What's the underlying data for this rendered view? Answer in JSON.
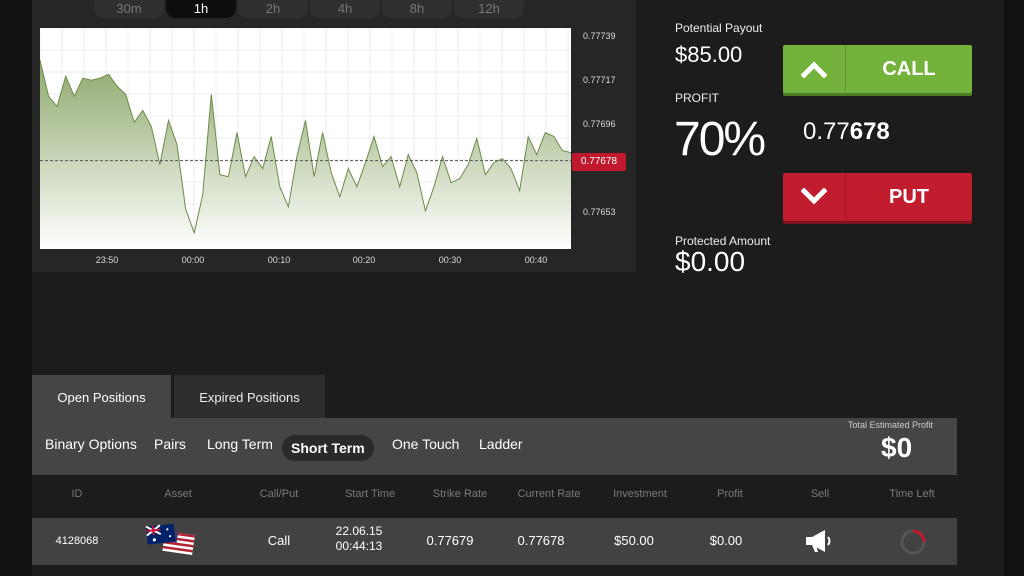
{
  "time_tabs": [
    "30m",
    "1h",
    "2h",
    "4h",
    "8h",
    "12h"
  ],
  "active_time_tab": "1h",
  "chart_data": {
    "type": "area",
    "x_tick_labels": [
      "23:50",
      "00:00",
      "00:10",
      "00:20",
      "00:30",
      "00:40"
    ],
    "x": [
      "23:42",
      "23:43",
      "23:44",
      "23:45",
      "23:46",
      "23:47",
      "23:48",
      "23:49",
      "23:50",
      "23:51",
      "23:52",
      "23:53",
      "23:54",
      "23:55",
      "23:56",
      "23:57",
      "23:58",
      "23:59",
      "00:00",
      "00:01",
      "00:02",
      "00:03",
      "00:04",
      "00:05",
      "00:06",
      "00:07",
      "00:08",
      "00:09",
      "00:10",
      "00:11",
      "00:12",
      "00:13",
      "00:14",
      "00:15",
      "00:16",
      "00:17",
      "00:18",
      "00:19",
      "00:20",
      "00:21",
      "00:22",
      "00:23",
      "00:24",
      "00:25",
      "00:26",
      "00:27",
      "00:28",
      "00:29",
      "00:30",
      "00:31",
      "00:32",
      "00:33",
      "00:34",
      "00:35",
      "00:36",
      "00:37",
      "00:38",
      "00:39",
      "00:40",
      "00:41",
      "00:42",
      "00:43",
      "00:44"
    ],
    "values": [
      0.77728,
      0.7771,
      0.77705,
      0.7772,
      0.7771,
      0.77719,
      0.77718,
      0.77719,
      0.77721,
      0.77715,
      0.77711,
      0.77697,
      0.77703,
      0.77695,
      0.77676,
      0.77698,
      0.77686,
      0.77654,
      0.77642,
      0.77661,
      0.77711,
      0.77671,
      0.7767,
      0.77692,
      0.7767,
      0.7768,
      0.77674,
      0.7769,
      0.77665,
      0.77655,
      0.7768,
      0.77698,
      0.7767,
      0.77692,
      0.77672,
      0.7766,
      0.77674,
      0.77665,
      0.77677,
      0.7769,
      0.77675,
      0.7768,
      0.77665,
      0.77681,
      0.77672,
      0.77653,
      0.77665,
      0.7768,
      0.77667,
      0.77669,
      0.77676,
      0.77689,
      0.77671,
      0.77677,
      0.77679,
      0.77674,
      0.77663,
      0.7769,
      0.77681,
      0.77692,
      0.7769,
      0.77683,
      0.77682
    ],
    "y_tick_labels": [
      "0.77739",
      "0.77717",
      "0.77696",
      "0.77674",
      "0.77653"
    ],
    "current_price_label": "0.77678",
    "ylim": [
      0.77634,
      0.77744
    ],
    "current_price": 0.77678,
    "grid": true,
    "colors": {
      "fill_top": "#8ea86b",
      "fill_bottom": "#ffffff",
      "line": "#6c8a4a",
      "price_tag": "#c0192e"
    }
  },
  "trade": {
    "potential_payout_label": "Potential Payout",
    "potential_payout_value": "$85.00",
    "profit_label": "PROFIT",
    "profit_value": "70%",
    "current_price_prefix": "0.77",
    "current_price_suffix": "678",
    "call_label": "CALL",
    "put_label": "PUT",
    "call_icon": "chevron-up-icon",
    "put_icon": "chevron-down-icon",
    "protected_amount_label": "Protected Amount",
    "protected_amount_value": "$0.00",
    "colors": {
      "call": "#74b33b",
      "put": "#c11d2f"
    }
  },
  "positions": {
    "tabs": [
      "Open Positions",
      "Expired Positions"
    ],
    "active_tab": "Open Positions",
    "filters": [
      "Binary Options",
      "Pairs",
      "Long Term",
      "Short Term",
      "One Touch",
      "Ladder"
    ],
    "active_filter": "Short Term",
    "total_estimated_profit_label": "Total Estimated Profit",
    "total_estimated_profit_value": "$0",
    "columns": [
      "ID",
      "Asset",
      "Call/Put",
      "Start Time",
      "Strike Rate",
      "Current Rate",
      "Investment",
      "Profit",
      "Sell",
      "Time Left"
    ],
    "rows": [
      {
        "id": "4128068",
        "asset_icon": "aud-usd-flags-icon",
        "call_put": "Call",
        "start_date": "22.06.15",
        "start_time": "00:44:13",
        "strike_rate": "0.77679",
        "current_rate": "0.77678",
        "investment": "$50.00",
        "profit": "$0.00",
        "sell_icon": "megaphone-icon",
        "time_left_fraction": 0.25
      }
    ]
  }
}
